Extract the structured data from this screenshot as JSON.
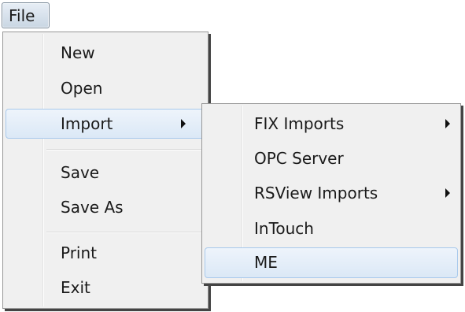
{
  "menubar": {
    "file_label": "File"
  },
  "file_menu": {
    "items": [
      {
        "label": "New"
      },
      {
        "label": "Open"
      },
      {
        "label": "Import"
      },
      {
        "label": "Save"
      },
      {
        "label": "Save As"
      },
      {
        "label": "Print"
      },
      {
        "label": "Exit"
      }
    ],
    "highlighted": "Import"
  },
  "import_submenu": {
    "items": [
      {
        "label": "FIX Imports",
        "has_submenu": true
      },
      {
        "label": "OPC Server",
        "has_submenu": false
      },
      {
        "label": "RSView Imports",
        "has_submenu": true
      },
      {
        "label": "InTouch",
        "has_submenu": false
      },
      {
        "label": "ME",
        "has_submenu": false
      }
    ],
    "highlighted": "ME"
  },
  "colors": {
    "menu_background": "#f0f0f0",
    "menu_border": "#979797",
    "highlight_border": "#a8c9ec",
    "highlight_fill": "#dbe8f6"
  }
}
